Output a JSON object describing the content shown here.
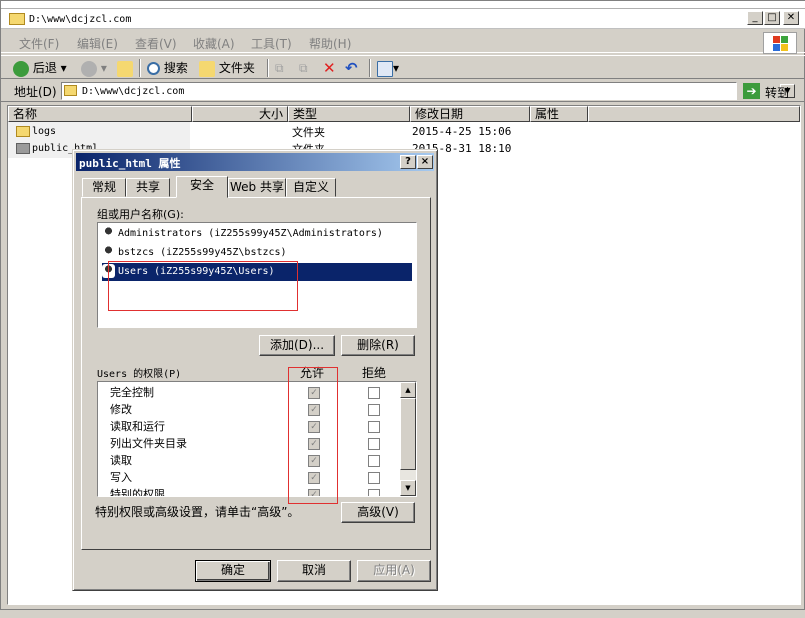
{
  "explorer": {
    "title": "D:\\www\\dcjzcl.com",
    "menu": [
      "文件(F)",
      "编辑(E)",
      "查看(V)",
      "收藏(A)",
      "工具(T)",
      "帮助(H)"
    ],
    "toolbar": {
      "back": "后退",
      "search": "搜索",
      "folders": "文件夹"
    },
    "address": {
      "label": "地址(D)",
      "value": "D:\\www\\dcjzcl.com",
      "go": "转到"
    },
    "columns": [
      "名称",
      "大小",
      "类型",
      "修改日期",
      "属性"
    ],
    "rows": [
      {
        "name": "logs",
        "type": "文件夹",
        "modified": "2015-4-25 15:06"
      },
      {
        "name": "public_html",
        "type": "文件夹",
        "modified": "2015-8-31 18:10"
      }
    ]
  },
  "dialog": {
    "title": "public_html 属性",
    "help_btn": "?",
    "close_btn": "×",
    "tabs": [
      "常规",
      "共享",
      "安全",
      "Web 共享",
      "自定义"
    ],
    "active_tab": "安全",
    "group_label": "组或用户名称(G):",
    "users": [
      "Administrators (iZ255s99y45Z\\Administrators)",
      "bstzcs (iZ255s99y45Z\\bstzcs)",
      "Users (iZ255s99y45Z\\Users)"
    ],
    "add_button": "添加(D)...",
    "remove_button": "删除(R)",
    "perm_label": "Users 的权限(P)",
    "allow_header": "允许",
    "deny_header": "拒绝",
    "permissions": [
      {
        "name": "完全控制",
        "allow": true,
        "deny": false
      },
      {
        "name": "修改",
        "allow": true,
        "deny": false
      },
      {
        "name": "读取和运行",
        "allow": true,
        "deny": false
      },
      {
        "name": "列出文件夹目录",
        "allow": true,
        "deny": false
      },
      {
        "name": "读取",
        "allow": true,
        "deny": false
      },
      {
        "name": "写入",
        "allow": true,
        "deny": false
      },
      {
        "name": "特别的权限",
        "allow": true,
        "deny": false
      }
    ],
    "advanced_hint": "特别权限或高级设置，请单击“高级”。",
    "advanced_button": "高级(V)",
    "ok_button": "确定",
    "cancel_button": "取消",
    "apply_button": "应用(A)"
  },
  "colors": {
    "dialog_title_start": "#0a246a",
    "dialog_title_end": "#a6caf0",
    "selection": "#0a246a",
    "highlight_box": "#e03030",
    "window_bg": "#d4d0c8"
  }
}
